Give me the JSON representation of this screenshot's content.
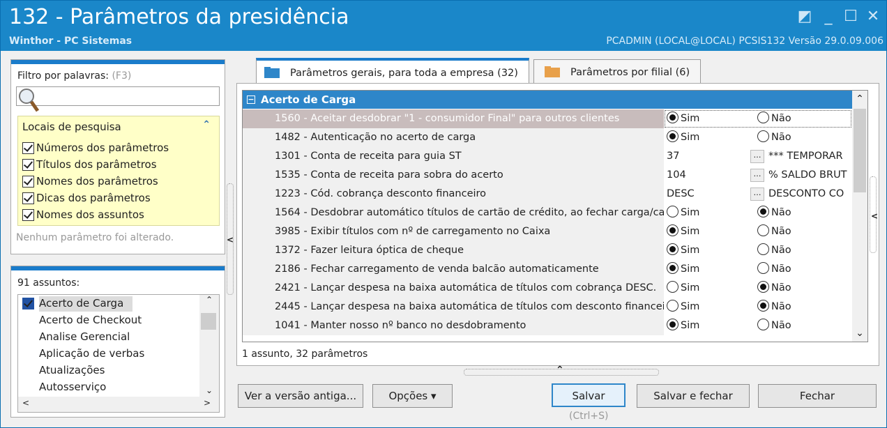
{
  "window": {
    "title": "132 - Parâmetros da presidência",
    "subtitle": "Winthor - PC Sistemas",
    "status": "PCADMIN (LOCAL@LOCAL)   PCSIS132  Versão  29.0.09.006"
  },
  "filter": {
    "label": "Filtro por palavras:",
    "shortcut": "(F3)",
    "value": ""
  },
  "locais": {
    "title": "Locais de pesquisa",
    "items": [
      "Números dos parâmetros",
      "Títulos dos parâmetros",
      "Nomes dos parâmetros",
      "Dicas dos parâmetros",
      "Nomes dos assuntos"
    ]
  },
  "no_change": "Nenhum parâmetro foi alterado.",
  "subjects": {
    "count_label": "91 assuntos:",
    "items": [
      "Acerto de Carga",
      "Acerto de Checkout",
      "Analise Gerencial",
      "Aplicação de verbas",
      "Atualizações",
      "Autosserviço"
    ]
  },
  "tabs": [
    {
      "label": "Parâmetros gerais, para toda a empresa",
      "count": "(32)"
    },
    {
      "label": "Parâmetros por filial",
      "count": "(6)"
    }
  ],
  "group": "Acerto de Carga",
  "rows": [
    {
      "title": "1560 - Aceitar desdobrar \"1 - consumidor Final\" para outros clientes",
      "type": "radio",
      "opt1": "Sim",
      "opt2": "Não",
      "value": "Sim"
    },
    {
      "title": "1482 - Autenticação no acerto de carga",
      "type": "radio",
      "opt1": "Sim",
      "opt2": "Não",
      "value": "Sim"
    },
    {
      "title": "1301 - Conta de receita para guia ST",
      "type": "lookup",
      "code": "37",
      "desc": "*** TEMPORAR"
    },
    {
      "title": "1535 - Conta de receita para sobra do acerto",
      "type": "lookup",
      "code": "104",
      "desc": "% SALDO BRUT"
    },
    {
      "title": "1223 - Cód. cobrança desconto financeiro",
      "type": "lookup",
      "code": "DESC",
      "desc": "DESCONTO CO"
    },
    {
      "title": "1564 - Desdobrar automático títulos de cartão de crédito, ao fechar carga/ca",
      "type": "radio",
      "opt1": "Sim",
      "opt2": "Não",
      "value": "Não"
    },
    {
      "title": "3985 - Exibir títulos com nº de carregamento no Caixa",
      "type": "radio",
      "opt1": "Sim",
      "opt2": "Não",
      "value": "Sim"
    },
    {
      "title": "1372 - Fazer leitura óptica de cheque",
      "type": "radio",
      "opt1": "Sim",
      "opt2": "Não",
      "value": "Sim"
    },
    {
      "title": "2186 - Fechar carregamento de venda balcão automaticamente",
      "type": "radio",
      "opt1": "Sim",
      "opt2": "Não",
      "value": "Sim"
    },
    {
      "title": "2421 - Lançar despesa na baixa automática de títulos com cobrança DESC.",
      "type": "radio",
      "opt1": "Sim",
      "opt2": "Não",
      "value": "Não"
    },
    {
      "title": "2445 - Lançar despesa na baixa automática de títulos com desconto financeir",
      "type": "radio",
      "opt1": "Sim",
      "opt2": "Não",
      "value": "Não"
    },
    {
      "title": "1041 - Manter nosso nº banco no desdobramento",
      "type": "radio",
      "opt1": "Sim",
      "opt2": "Não",
      "value": "Sim"
    }
  ],
  "summary": "1 assunto, 32 parâmetros",
  "buttons": {
    "old": "Ver a versão antiga...",
    "options": "Opções",
    "save": "Salvar",
    "save_hint": "(Ctrl+S)",
    "save_close": "Salvar e fechar",
    "close": "Fechar"
  },
  "colors": {
    "titlebar": "#1a87c9",
    "accent": "#2e86c9",
    "highlight": "#ffffc8"
  }
}
